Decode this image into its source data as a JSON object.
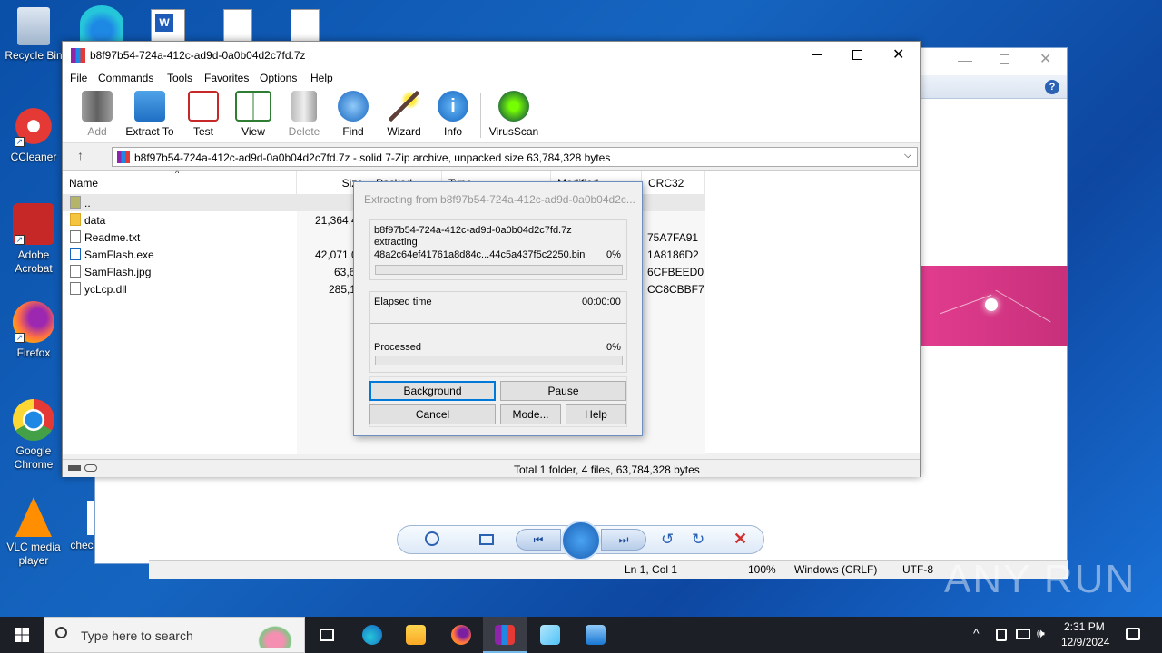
{
  "desktop": {
    "icons": [
      {
        "label": "Recycle Bin"
      },
      {
        "label": "CCleaner"
      },
      {
        "label": "Adobe Acrobat"
      },
      {
        "label": "Firefox"
      },
      {
        "label": "Google Chrome"
      },
      {
        "label": "VLC media player"
      },
      {
        "label": "chec"
      }
    ]
  },
  "winrar": {
    "title": "b8f97b54-724a-412c-ad9d-0a0b04d2c7fd.7z",
    "menu": [
      "File",
      "Commands",
      "Tools",
      "Favorites",
      "Options",
      "Help"
    ],
    "toolbar": [
      "Add",
      "Extract To",
      "Test",
      "View",
      "Delete",
      "Find",
      "Wizard",
      "Info",
      "VirusScan"
    ],
    "path": "b8f97b54-724a-412c-ad9d-0a0b04d2c7fd.7z - solid 7-Zip archive, unpacked size 63,784,328 bytes",
    "columns": {
      "name": "Name",
      "size": "Size",
      "packed": "Packed",
      "type": "Type",
      "modified": "Modified",
      "crc": "CRC32"
    },
    "files": [
      {
        "name": "..",
        "size": "",
        "crc": ""
      },
      {
        "name": "data",
        "size": "21,364,4",
        "crc": ""
      },
      {
        "name": "Readme.txt",
        "size": "",
        "crc": "75A7FA91"
      },
      {
        "name": "SamFlash.exe",
        "size": "42,071,0",
        "crc": "1A8186D2"
      },
      {
        "name": "SamFlash.jpg",
        "size": "63,6",
        "crc": "6CFBEED0"
      },
      {
        "name": "ycLcp.dll",
        "size": "285,1",
        "crc": "CC8CBBF7"
      }
    ],
    "status": "Total 1 folder, 4 files, 63,784,328 bytes"
  },
  "dialog": {
    "title": "Extracting from b8f97b54-724a-412c-ad9d-0a0b04d2c...",
    "archive": "b8f97b54-724a-412c-ad9d-0a0b04d2c7fd.7z",
    "action": "extracting",
    "current_file": "48a2c64ef41761a8d84c...44c5a437f5c2250.bin",
    "file_percent": "0%",
    "elapsed_label": "Elapsed time",
    "elapsed_value": "00:00:00",
    "processed_label": "Processed",
    "processed_percent": "0%",
    "buttons": {
      "background": "Background",
      "pause": "Pause",
      "cancel": "Cancel",
      "mode": "Mode...",
      "help": "Help"
    }
  },
  "notepad_status": {
    "pos": "Ln 1, Col 1",
    "zoom": "100%",
    "eol": "Windows (CRLF)",
    "enc": "UTF-8"
  },
  "taskbar": {
    "search_placeholder": "Type here to search",
    "time": "2:31 PM",
    "date": "12/9/2024"
  },
  "watermark": "ANY RUN"
}
